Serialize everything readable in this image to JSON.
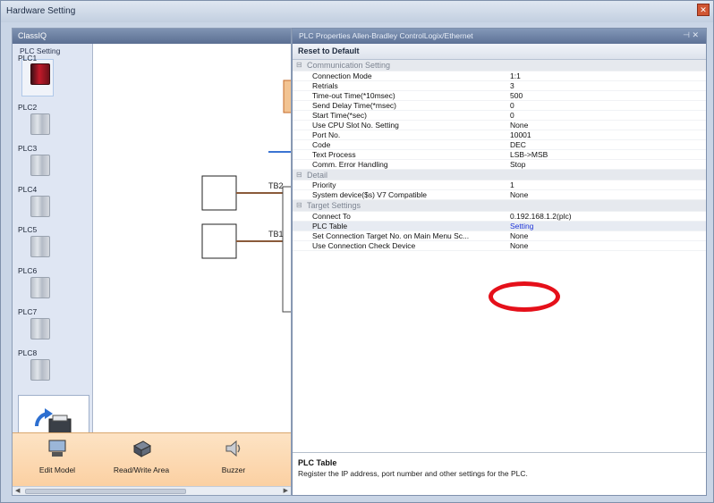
{
  "window": {
    "title": "Hardware Setting"
  },
  "left_panel": {
    "header": "ClassIQ",
    "plc_setting_title": "PLC Setting",
    "plcs": [
      {
        "label": "PLC1",
        "state": "selected"
      },
      {
        "label": "PLC2"
      },
      {
        "label": "PLC3"
      },
      {
        "label": "PLC4"
      },
      {
        "label": "PLC5"
      },
      {
        "label": "PLC6"
      },
      {
        "label": "PLC7"
      },
      {
        "label": "PLC8"
      }
    ],
    "diagram": {
      "label_top": "TB2",
      "label_bottom": "TB1"
    },
    "tools": [
      {
        "label": "Edit Model",
        "icon": "monitor-icon"
      },
      {
        "label": "Read/Write Area",
        "icon": "read-write-area-icon"
      },
      {
        "label": "Buzzer",
        "icon": "buzzer-icon"
      }
    ]
  },
  "props_panel": {
    "header": "PLC Properties Allen-Bradley ControlLogix/Ethernet",
    "reset_label": "Reset to Default",
    "categories": [
      {
        "name": "Communication Setting",
        "rows": [
          {
            "key": "Connection Mode",
            "value": "1:1"
          },
          {
            "key": "Retrials",
            "value": "3"
          },
          {
            "key": "Time-out Time(*10msec)",
            "value": "500"
          },
          {
            "key": "Send Delay Time(*msec)",
            "value": "0"
          },
          {
            "key": "Start Time(*sec)",
            "value": "0"
          },
          {
            "key": "Use CPU Slot No. Setting",
            "value": "None"
          },
          {
            "key": "Port No.",
            "value": "10001"
          },
          {
            "key": "Code",
            "value": "DEC"
          },
          {
            "key": "Text Process",
            "value": "LSB->MSB"
          },
          {
            "key": "Comm. Error Handling",
            "value": "Stop"
          }
        ]
      },
      {
        "name": "Detail",
        "rows": [
          {
            "key": "Priority",
            "value": "1"
          },
          {
            "key": "System device($s) V7 Compatible",
            "value": "None"
          }
        ]
      },
      {
        "name": "Target Settings",
        "rows": [
          {
            "key": "Connect To",
            "value": "0.192.168.1.2(plc)"
          },
          {
            "key": "PLC Table",
            "value": "Setting",
            "selected": true
          },
          {
            "key": "Set Connection Target No. on Main Menu Sc...",
            "value": "None"
          },
          {
            "key": "Use Connection Check Device",
            "value": "None"
          }
        ]
      }
    ],
    "description": {
      "title": "PLC Table",
      "text": "Register the IP address, port number and other settings for the PLC."
    }
  },
  "colors": {
    "highlight": "#e5101a",
    "link": "#2036d8",
    "plc1_red": "#c21a2a",
    "tools_bg": "#fbd0a2"
  }
}
